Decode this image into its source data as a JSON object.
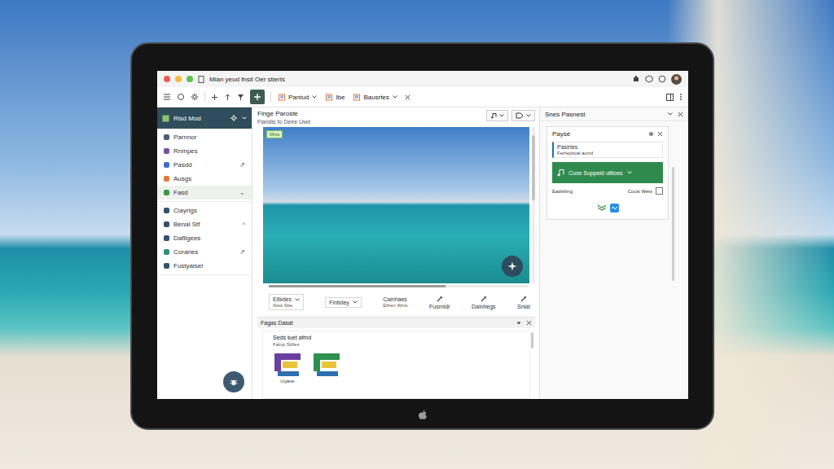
{
  "window": {
    "title": "Mian yeud fnsit Oer stierts"
  },
  "toolbar": {
    "items": [
      {
        "label": "Pantud",
        "dropdown": true
      },
      {
        "label": "Ibe",
        "dropdown": false
      },
      {
        "label": "Bausrtes",
        "dropdown": true
      }
    ]
  },
  "sidebar": {
    "header": "Risd Mod",
    "groups": [
      {
        "items": [
          {
            "label": "Parnnor",
            "color": "#4a5d7a",
            "selected": false
          },
          {
            "label": "Rnmpes",
            "color": "#7b4fa0",
            "selected": false
          },
          {
            "label": "Pasdd",
            "color": "#3b6fc4",
            "selected": false,
            "mark": "↗"
          },
          {
            "label": "Ausgs",
            "color": "#e07b39",
            "selected": false
          },
          {
            "label": "Fasd",
            "color": "#3a9a4a",
            "selected": true,
            "mark": "⌄"
          }
        ]
      },
      {
        "items": [
          {
            "label": "Ciayrigs",
            "color": "#34506e",
            "selected": false
          },
          {
            "label": "Benal Stf",
            "color": "#34506e",
            "selected": false,
            "mark": "^"
          },
          {
            "label": "Dafllgees",
            "color": "#34506e",
            "selected": false
          },
          {
            "label": "Coraries",
            "color": "#2f8f6f",
            "selected": false,
            "mark": "↗"
          },
          {
            "label": "Fustyaisel",
            "color": "#34506e",
            "selected": false
          }
        ]
      }
    ]
  },
  "editor": {
    "title": "Finge Paroste",
    "subtitle": "Flandis fo Deire Uwd",
    "image_badge": "Mvis",
    "scroll": {
      "level": 0.68
    },
    "controls": [
      {
        "kind": "select",
        "label": "Eibides",
        "sub": "Stes Stie",
        "dropdown": true
      },
      {
        "kind": "select",
        "label": "Fintidey",
        "dropdown": true
      },
      {
        "kind": "text",
        "label": "Cainhaes",
        "sub": "Eihen Wins",
        "dropdown": false
      },
      {
        "kind": "tool",
        "label": "Fusrnidr",
        "dropdown": false
      },
      {
        "kind": "tool",
        "label": "Dainhegs",
        "dropdown": false
      },
      {
        "kind": "tool",
        "label": "Sniat",
        "dropdown": false
      }
    ]
  },
  "bottom_panel": {
    "title": "Fagas Dasat",
    "heading": "Seds tuet afmd",
    "subheading": "Fainp Sitlles",
    "tiles": [
      {
        "caption": "Uyane",
        "color": "#6b3fa0"
      },
      {
        "color": "#2f8f4f"
      }
    ]
  },
  "side_panel": {
    "title": "Snes Pasnest",
    "card": {
      "title": "Paysé",
      "field_label": "Pasirtes",
      "field_value": "Ferreptical aurrd",
      "button": "Cuse Suppeld ulttoes",
      "option": "Eadshing",
      "checkbox": {
        "label": "Cocsi Wets",
        "checked": false
      }
    }
  }
}
